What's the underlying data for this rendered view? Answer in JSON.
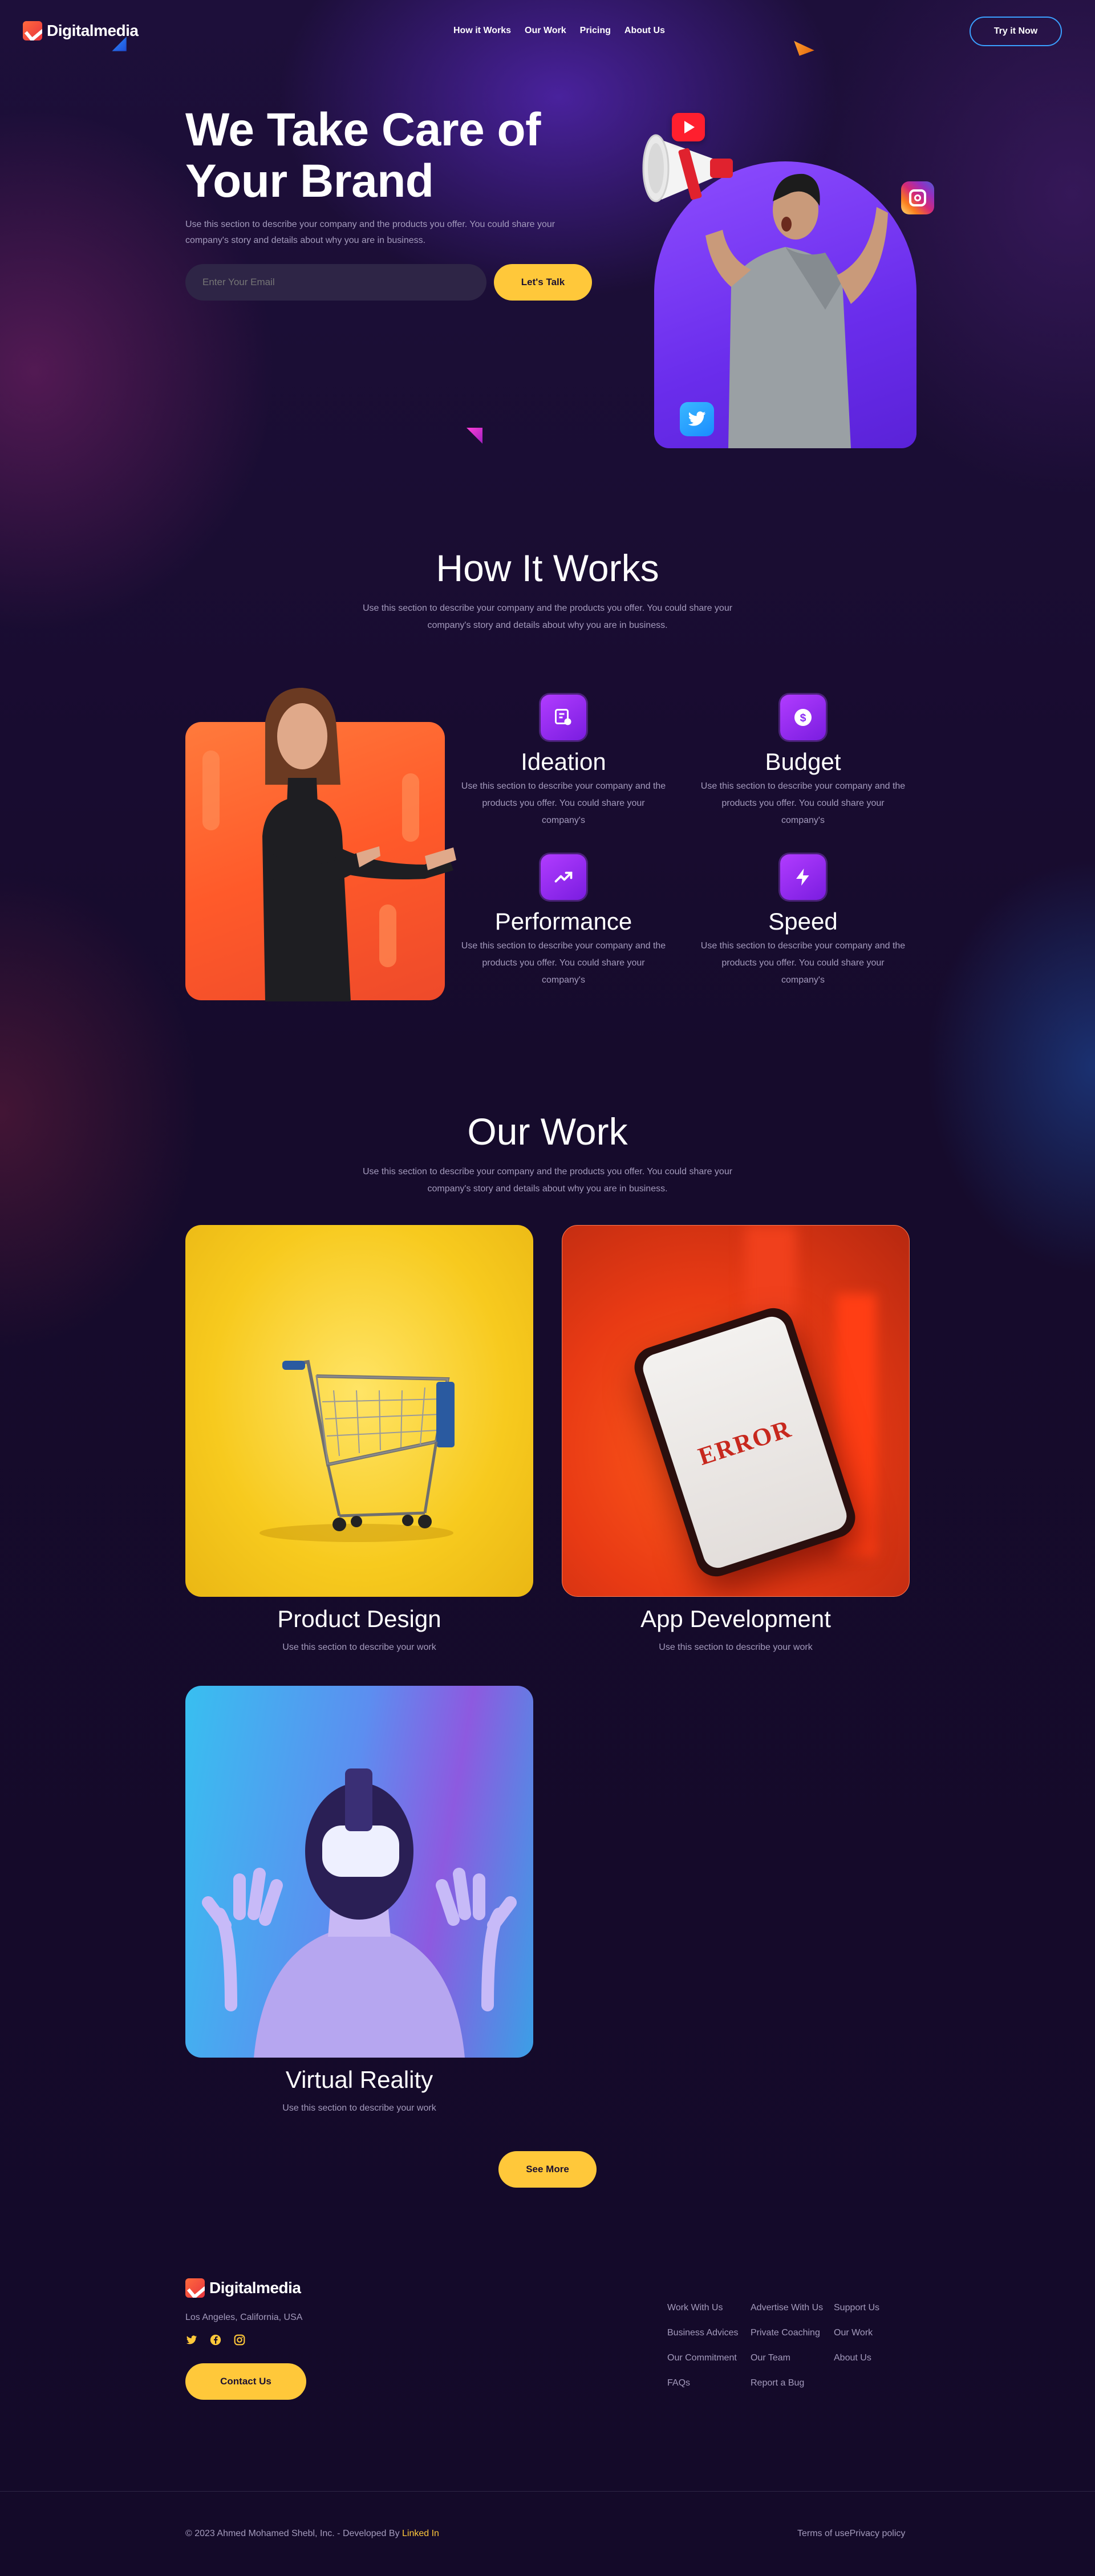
{
  "header": {
    "brand": "Digitalmedia",
    "nav": [
      "How it Works",
      "Our Work",
      "Pricing",
      "About Us"
    ],
    "cta": "Try it Now"
  },
  "hero": {
    "title_line1": "We Take Care of",
    "title_line2": "Your Brand",
    "description": "Use this section to describe your company and the products you offer. You could share your company's story and details about why you are in business.",
    "email_placeholder": "Enter Your Email",
    "button": "Let's Talk"
  },
  "how_it_works": {
    "title": "How It Works",
    "description": "Use this section to describe your company and the products you offer. You could share your company's story and details about why you are in business.",
    "features": [
      {
        "title": "Ideation",
        "text": "Use this section to describe your company and the products you offer. You could share your company's",
        "icon": "ideation-icon"
      },
      {
        "title": "Budget",
        "text": "Use this section to describe your company and the products you offer. You could share your company's",
        "icon": "dollar-icon"
      },
      {
        "title": "Performance",
        "text": "Use this section to describe your company and the products you offer. You could share your company's",
        "icon": "trending-up-icon"
      },
      {
        "title": "Speed",
        "text": "Use this section to describe your company and the products you offer. You could share your company's",
        "icon": "lightning-icon"
      }
    ]
  },
  "our_work": {
    "title": "Our Work",
    "description": "Use this section to describe your company and the products you offer. You could share your company's story and details about why you are in business.",
    "projects": [
      {
        "title": "Product Design",
        "text": "Use this section to describe your work"
      },
      {
        "title": "App Development",
        "text": "Use this section to describe your work",
        "screen_text": "ERROR"
      },
      {
        "title": "Virtual Reality",
        "text": "Use this section to describe your work"
      }
    ],
    "see_more": "See More"
  },
  "footer": {
    "brand": "Digitalmedia",
    "location": "Los Angeles, California, USA",
    "contact": "Contact Us",
    "links_col1": [
      "Work With Us",
      "Business Advices",
      "Our Commitment",
      "FAQs"
    ],
    "links_col2": [
      "Advertise With Us",
      "Private Coaching",
      "Our Team",
      "Report a Bug"
    ],
    "links_col3": [
      "Support Us",
      "Our Work",
      "About Us"
    ],
    "copyright": "© 2023 Ahmed Mohamed Shebl, Inc. - Developed By",
    "copyright_link": "Linked In",
    "terms": "Terms of use",
    "privacy": "Privacy policy"
  },
  "colors": {
    "background": "#150b2b",
    "accent_yellow": "#ffc83a",
    "accent_purple": "#8b2cf5",
    "accent_blue": "#3aa0ff",
    "brand_orange": "#ff5a3c"
  }
}
